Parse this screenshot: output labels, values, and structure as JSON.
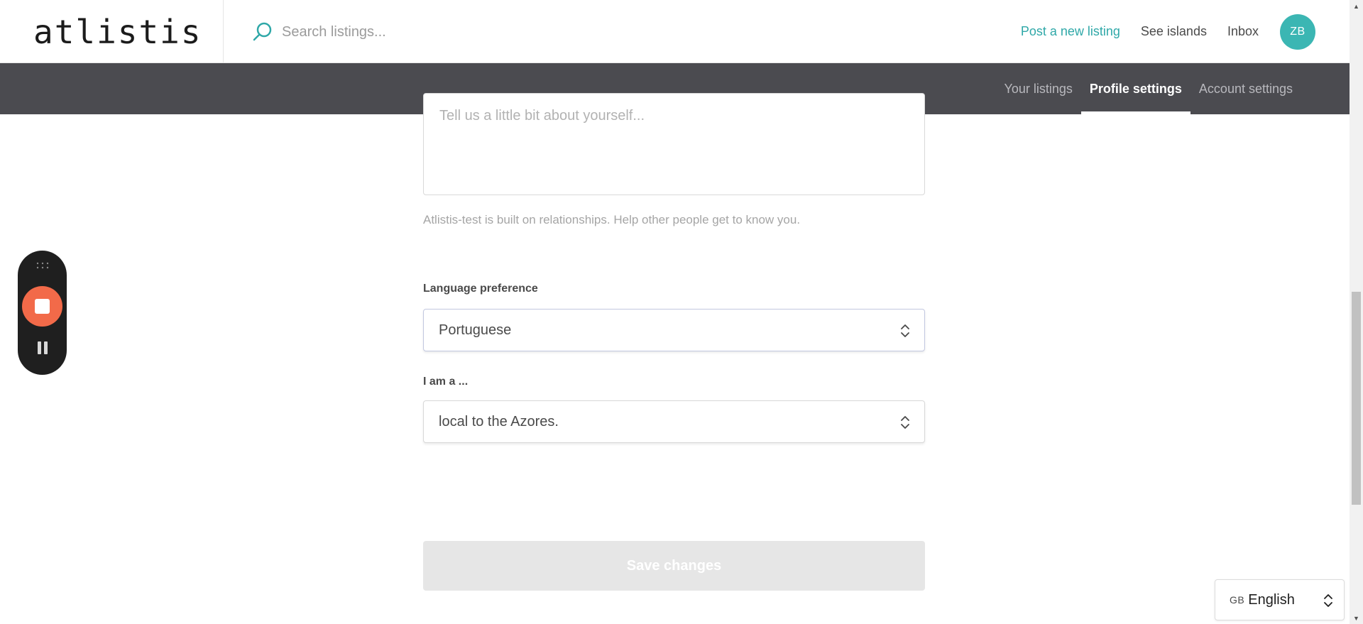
{
  "app": {
    "logo_text": "atlistis"
  },
  "search": {
    "placeholder": "Search listings..."
  },
  "top_nav": {
    "post_listing": "Post a new listing",
    "see_islands": "See islands",
    "inbox": "Inbox",
    "avatar_initials": "ZB"
  },
  "sub_nav": {
    "tabs": [
      {
        "label": "Your listings",
        "active": false
      },
      {
        "label": "Profile settings",
        "active": true
      },
      {
        "label": "Account settings",
        "active": false
      }
    ]
  },
  "form": {
    "bio_placeholder": "Tell us a little bit about yourself...",
    "bio_helper": "Atlistis-test is built on relationships. Help other people get to know you.",
    "language_label": "Language preference",
    "language_value": "Portuguese",
    "role_label": "I am a ...",
    "role_value": "local to the Azores.",
    "save_label": "Save changes"
  },
  "footer_language": {
    "flag": "GB",
    "value": "English"
  },
  "recorder": {
    "icons": [
      "grip-icon",
      "stop-icon",
      "pause-icon"
    ]
  },
  "colors": {
    "accent": "#2fa8a8",
    "avatar": "#3bb6b3",
    "subnav_bg": "#4b4b50",
    "record": "#f26a49",
    "save_disabled": "#e6e6e6"
  }
}
